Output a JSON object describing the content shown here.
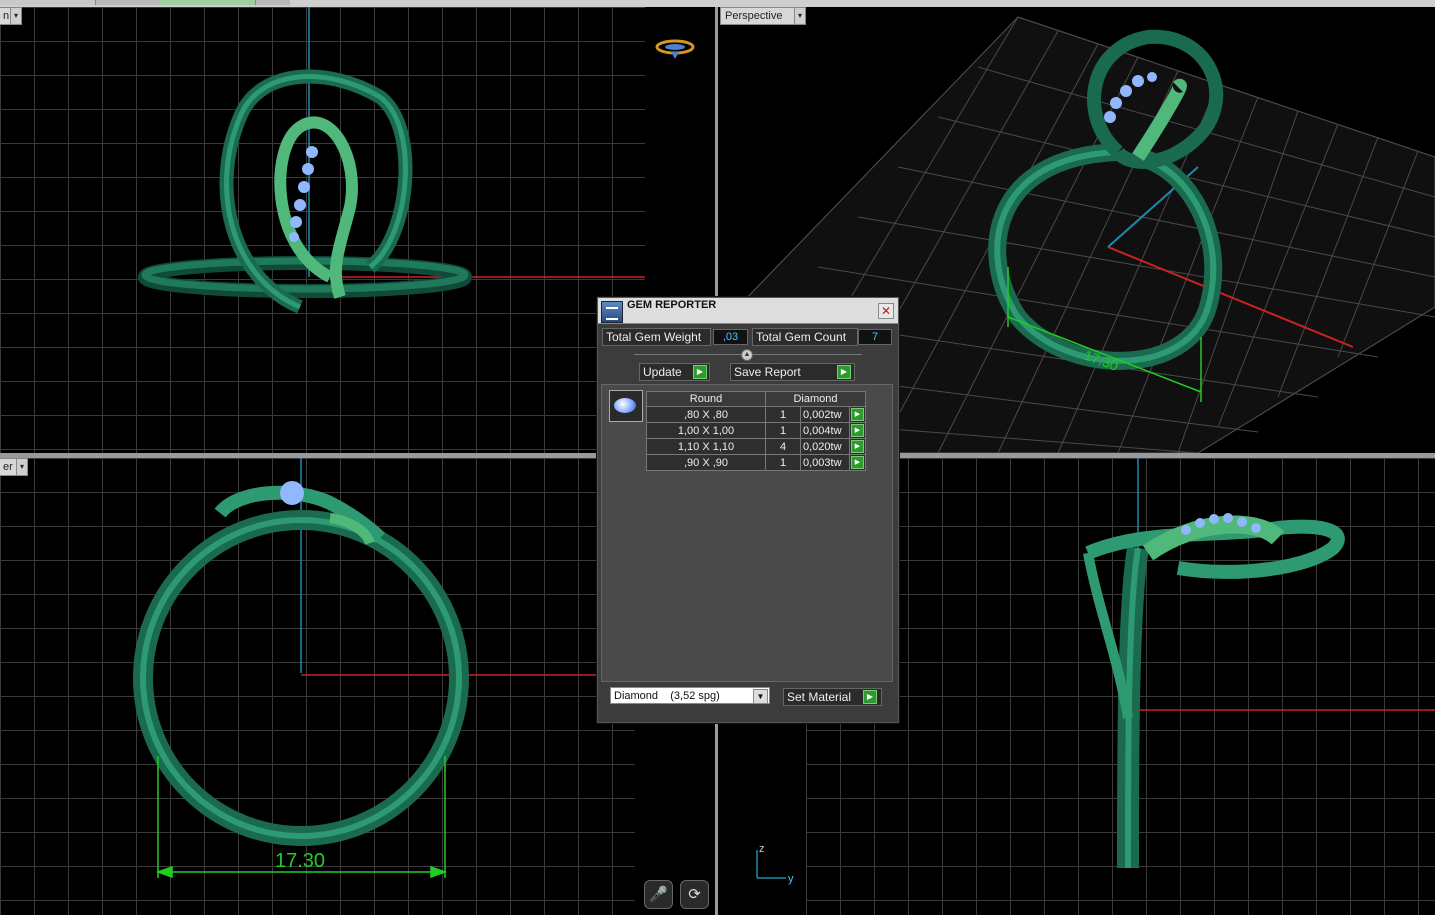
{
  "viewports": {
    "top_left": {
      "label": "n"
    },
    "bottom_left": {
      "label": "er"
    },
    "top_right": {
      "label": "Perspective"
    },
    "perspective_dimension": "17.30",
    "front_dimension": "17.30"
  },
  "gem_reporter": {
    "title": "GEM REPORTER",
    "total_weight_label": "Total Gem Weight",
    "total_weight_value": ",03",
    "total_count_label": "Total Gem Count",
    "total_count_value": "7",
    "update_label": "Update",
    "save_report_label": "Save Report",
    "table": {
      "headers": [
        "Round",
        "Diamond"
      ],
      "rows": [
        {
          "size": ",80 X ,80",
          "count": "1",
          "weight": "0,002tw"
        },
        {
          "size": "1,00 X 1,00",
          "count": "1",
          "weight": "0,004tw"
        },
        {
          "size": "1,10 X 1,10",
          "count": "4",
          "weight": "0,020tw"
        },
        {
          "size": ",90 X ,90",
          "count": "1",
          "weight": "0,003tw"
        }
      ]
    },
    "material_select": "Diamond    (3,52 spg)",
    "set_material_label": "Set Material"
  },
  "axis_labels": {
    "z": "z",
    "y": "y"
  },
  "colors": {
    "ring": "#1e7a5a",
    "ring_light": "#4fb87a",
    "gem": "#8fb8ff",
    "dimension": "#22cc22",
    "axis_x": "#cc2222",
    "axis_y": "#1e8aa8"
  }
}
